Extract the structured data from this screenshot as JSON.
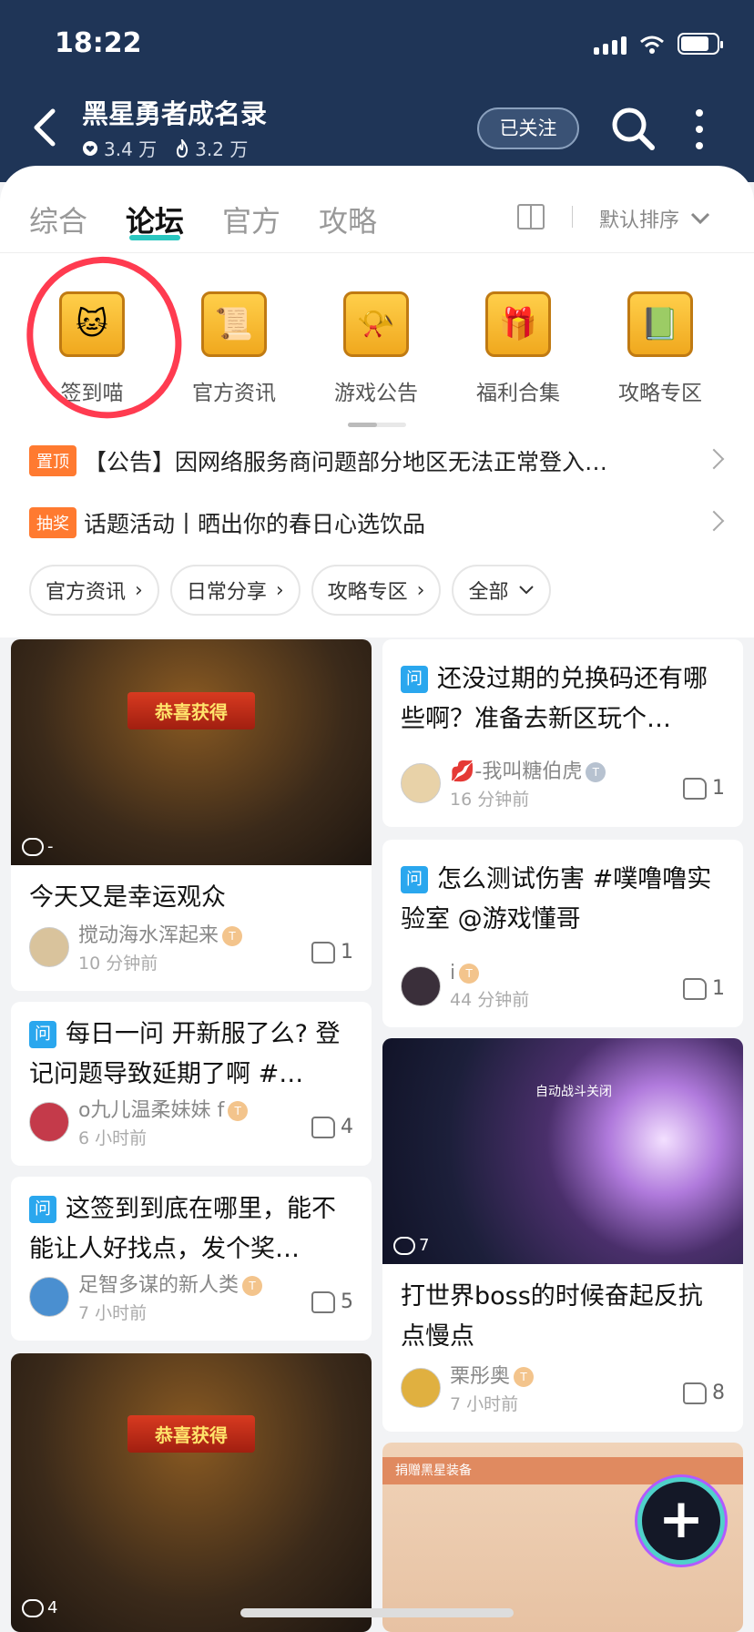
{
  "status_bar": {
    "time": "18:22",
    "battery_level": 0.8
  },
  "header": {
    "title": "黑星勇者成名录",
    "followers": "3.4 万",
    "hot": "3.2 万",
    "follow_label": "已关注"
  },
  "tabs": [
    "综合",
    "论坛",
    "官方",
    "攻略"
  ],
  "sort_label": "默认排序",
  "quick_entries": [
    {
      "label": "签到喵",
      "icon": "lucky-cat-icon"
    },
    {
      "label": "官方资讯",
      "icon": "scroll-news-icon"
    },
    {
      "label": "游戏公告",
      "icon": "announcement-icon"
    },
    {
      "label": "福利合集",
      "icon": "treasure-chest-icon"
    },
    {
      "label": "攻略专区",
      "icon": "guide-book-icon"
    }
  ],
  "notices": [
    {
      "tag": "置顶",
      "text": "【公告】因网络服务商问题部分地区无法正常登入…"
    },
    {
      "tag": "抽奖",
      "text": "话题活动丨晒出你的春日心选饮品"
    }
  ],
  "chips": [
    "官方资讯",
    "日常分享",
    "攻略专区",
    "全部"
  ],
  "posts": [
    {
      "title": "今天又是幸运观众",
      "author": "搅动海水浑起来",
      "time": "10 分钟前",
      "likes": "1",
      "comment_count": "-",
      "banner": "恭喜获得"
    },
    {
      "title": "还没过期的兑换码还有哪些啊？准备去新区玩个…",
      "author": "💋-我叫糖伯虎",
      "time": "16 分钟前",
      "likes": "1",
      "qa": "问"
    },
    {
      "title": "怎么测试伤害 #噗噜噜实验室 @游戏懂哥",
      "author": "i",
      "time": "44 分钟前",
      "likes": "1",
      "qa": "问"
    },
    {
      "title": "每日一问 开新服了么? 登记问题导致延期了啊 #…",
      "author": "o九儿温柔妹妹 f",
      "time": "6 小时前",
      "likes": "4",
      "qa": "问"
    },
    {
      "title": "打世界boss的时候奋起反抗点慢点",
      "author": "栗彤奥",
      "time": "7 小时前",
      "likes": "8",
      "comment_count": "7",
      "img_text": "自动战斗关闭"
    },
    {
      "title": "这签到到底在哪里，能不能让人好找点，发个奖…",
      "author": "足智多谋的新人类",
      "time": "7 小时前",
      "likes": "5",
      "qa": "问"
    },
    {
      "comment_count": "4",
      "banner": "恭喜获得"
    },
    {
      "img_text": "捐赠黑星装备"
    }
  ]
}
